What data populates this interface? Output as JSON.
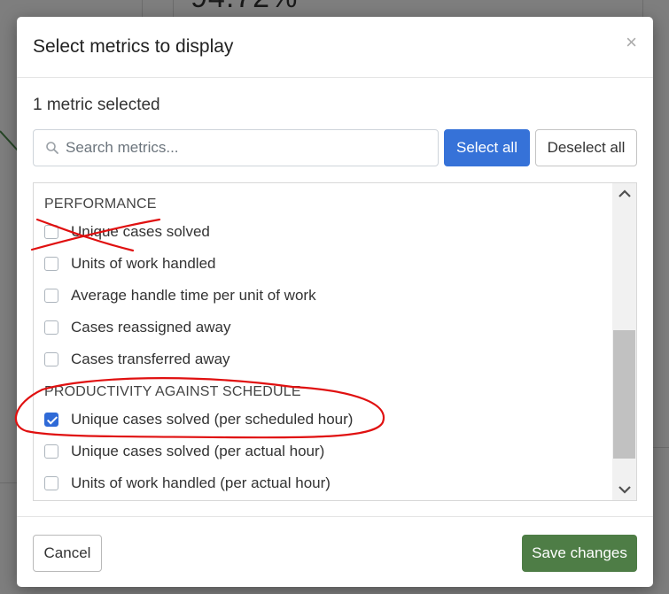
{
  "background": {
    "metric_value": "94.72%"
  },
  "modal": {
    "title": "Select metrics to display",
    "close_icon": "close-icon",
    "selected_count": "1 metric selected",
    "search": {
      "placeholder": "Search metrics...",
      "value": "",
      "icon": "search-icon"
    },
    "select_all_label": "Select all",
    "deselect_all_label": "Deselect all",
    "groups": [
      {
        "header": "PERFORMANCE",
        "metrics": [
          {
            "label": "Unique cases solved",
            "checked": false
          },
          {
            "label": "Units of work handled",
            "checked": false
          },
          {
            "label": "Average handle time per unit of work",
            "checked": false
          },
          {
            "label": "Cases reassigned away",
            "checked": false
          },
          {
            "label": "Cases transferred away",
            "checked": false
          }
        ]
      },
      {
        "header": "PRODUCTIVITY AGAINST SCHEDULE",
        "metrics": [
          {
            "label": "Unique cases solved (per scheduled hour)",
            "checked": true
          },
          {
            "label": "Unique cases solved (per actual hour)",
            "checked": false
          },
          {
            "label": "Units of work handled (per actual hour)",
            "checked": false
          }
        ]
      }
    ],
    "cancel_label": "Cancel",
    "save_label": "Save changes"
  },
  "colors": {
    "primary": "#3672d8",
    "save": "#4e7d46",
    "annotation": "#e01010"
  }
}
